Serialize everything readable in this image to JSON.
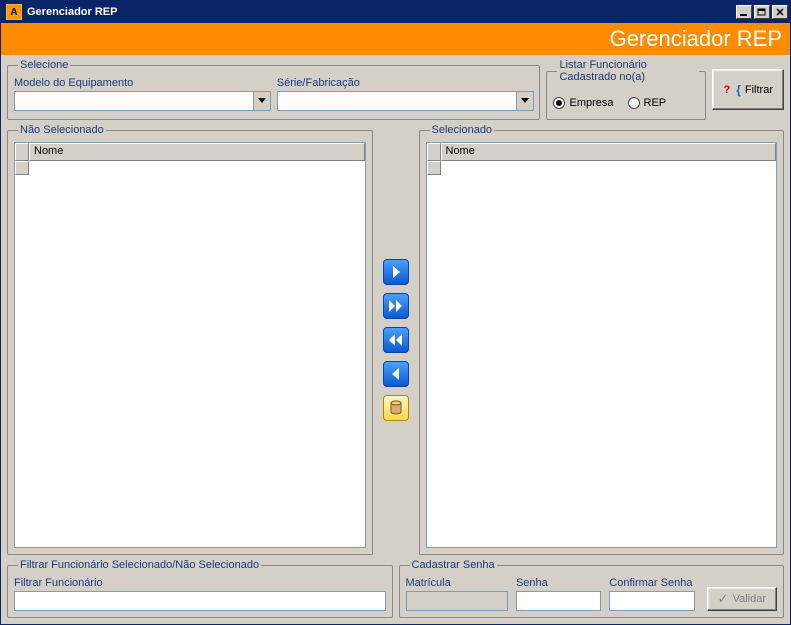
{
  "window": {
    "title": "Gerenciador REP"
  },
  "banner": {
    "title": "Gerenciador REP"
  },
  "selecione": {
    "legend": "Selecione",
    "modelo_label": "Modelo do Equipamento",
    "modelo_value": "",
    "serie_label": "Série/Fabricação",
    "serie_value": ""
  },
  "listar": {
    "legend": "Listar Funcionário Cadastrado no(a)",
    "options": [
      {
        "label": "Empresa",
        "checked": true
      },
      {
        "label": "REP",
        "checked": false
      }
    ]
  },
  "filtrar_btn": {
    "label": "Filtrar"
  },
  "lists": {
    "nao_selecionado": {
      "legend": "Não Selecionado",
      "col_header": "Nome",
      "rows": []
    },
    "selecionado": {
      "legend": "Selecionado",
      "col_header": "Nome",
      "rows": []
    }
  },
  "transfer": {
    "move_right": ">",
    "move_all_right": ">>",
    "move_all_left": "<<",
    "move_left": "<",
    "db": "db"
  },
  "filtrar_func": {
    "legend": "Filtrar Funcionário Selecionado/Não Selecionado",
    "label": "Filtrar Funcionário",
    "value": ""
  },
  "senha": {
    "legend": "Cadastrar Senha",
    "matricula_label": "Matrícula",
    "matricula_value": "",
    "senha_label": "Senha",
    "senha_value": "",
    "confirmar_label": "Confirmar Senha",
    "confirmar_value": "",
    "validar_label": "Validar"
  }
}
